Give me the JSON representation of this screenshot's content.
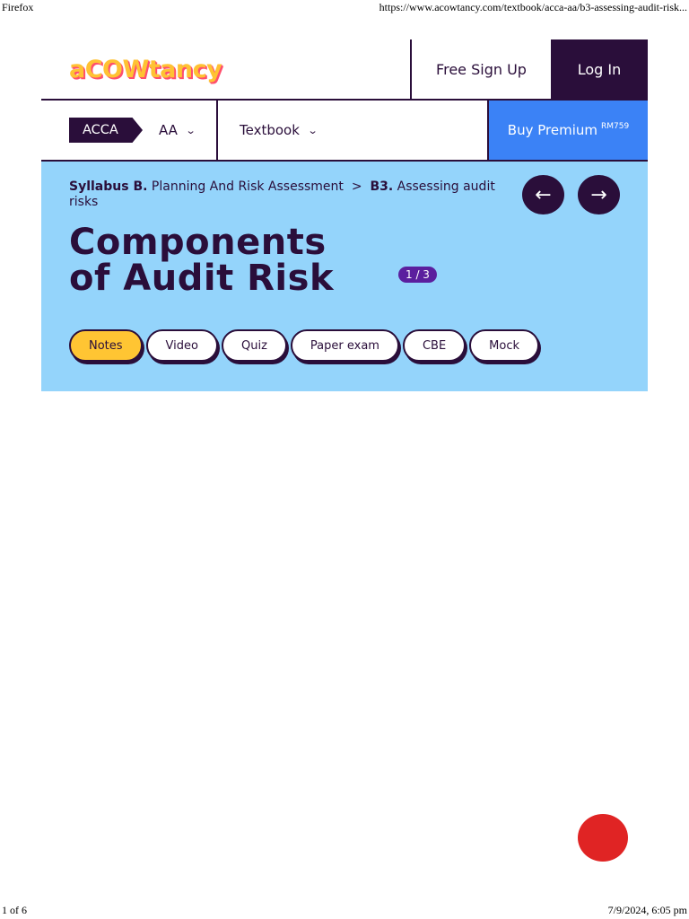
{
  "print": {
    "app": "Firefox",
    "url": "https://www.acowtancy.com/textbook/acca-aa/b3-assessing-audit-risk...",
    "page": "1 of 6",
    "datetime": "7/9/2024, 6:05 pm"
  },
  "header": {
    "logo": "aCOWtancy",
    "signup_label": "Free Sign Up",
    "login_label": "Log In"
  },
  "nav": {
    "acca_label": "ACCA",
    "paper_label": "AA",
    "section_label": "Textbook",
    "buy_label": "Buy Premium",
    "price": "RM759"
  },
  "hero": {
    "crumb_syllabus": "Syllabus B.",
    "crumb_section": "Planning And Risk Assessment",
    "crumb_sep": ">",
    "crumb_sub": "B3.",
    "crumb_topic": "Assessing audit risks",
    "title_line1": "Components",
    "title_line2": "of Audit Risk",
    "pager": "1 / 3",
    "prev_icon": "arrow-left-icon",
    "next_icon": "arrow-right-icon"
  },
  "tabs": [
    "Notes",
    "Video",
    "Quiz",
    "Paper exam",
    "CBE",
    "Mock"
  ],
  "colors": {
    "brand_dark": "#2a0e3a",
    "hero_bg": "#94d4fb",
    "buy_bg": "#3b82f6",
    "active_tab": "#ffc533",
    "fab": "#e02424"
  }
}
